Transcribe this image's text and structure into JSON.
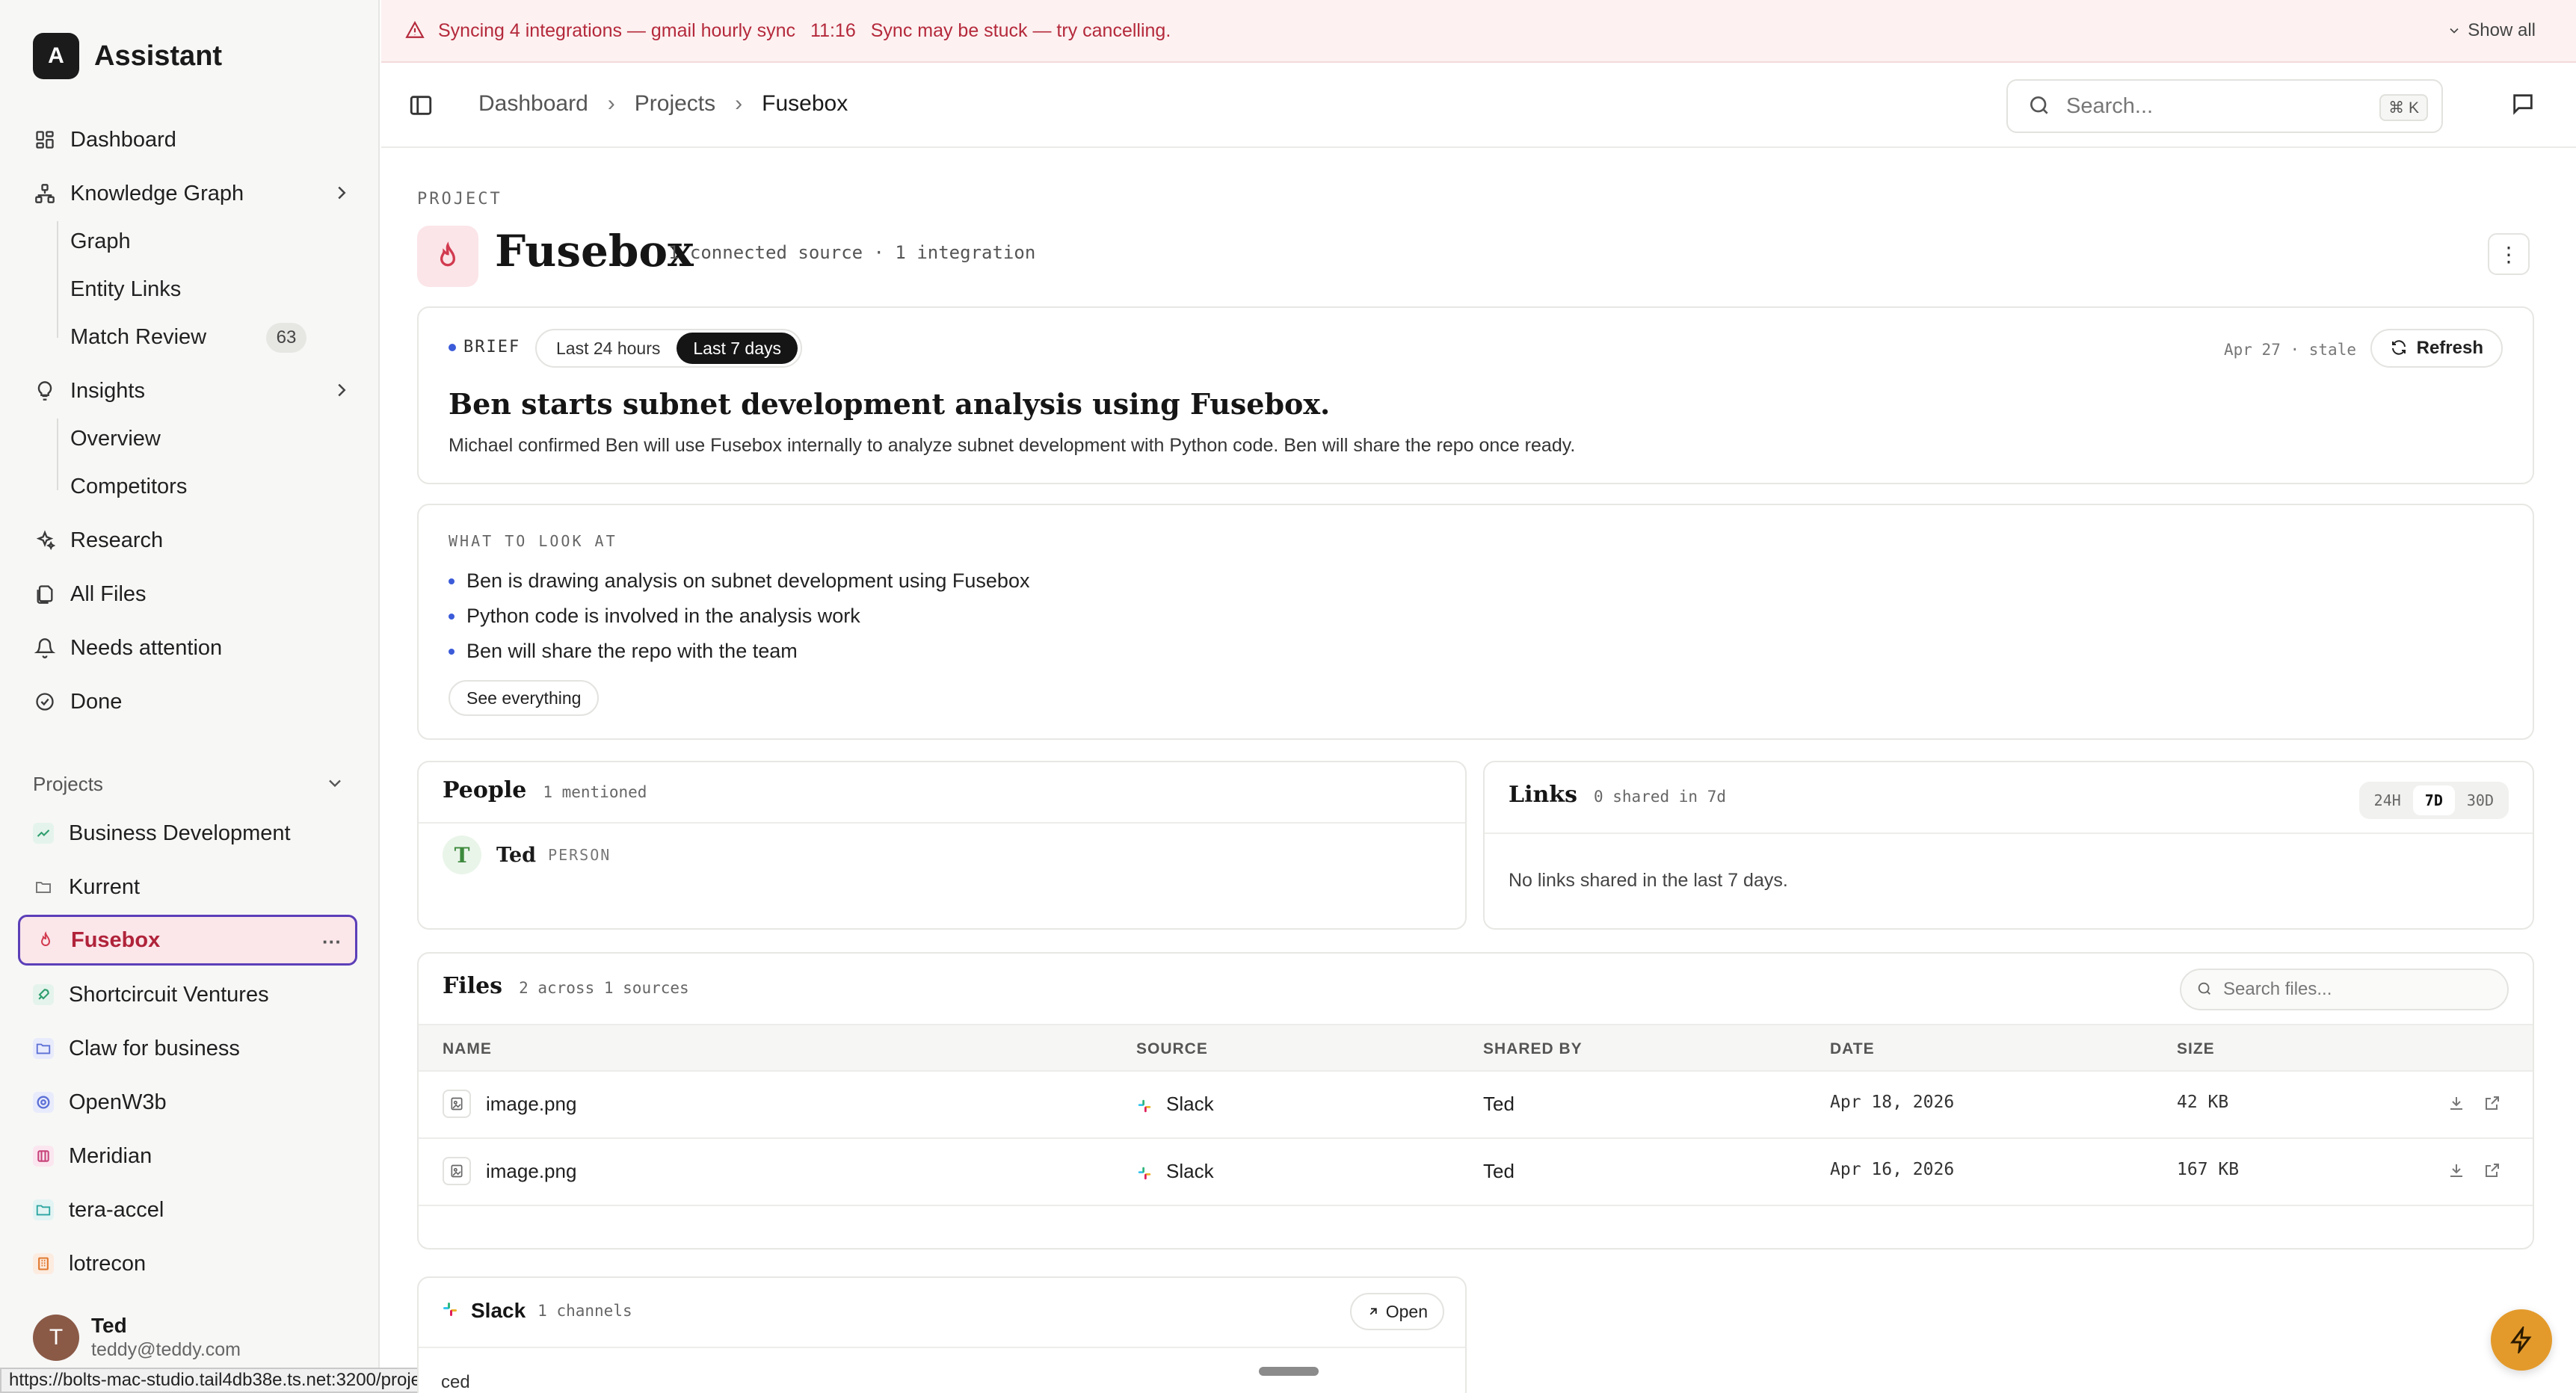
{
  "app": {
    "logo_letter": "A",
    "name": "Assistant"
  },
  "sidebar": {
    "nav": [
      {
        "label": "Dashboard",
        "icon": "dashboard-icon"
      },
      {
        "label": "Knowledge Graph",
        "icon": "graph-icon",
        "expandable": true
      },
      {
        "label": "Insights",
        "icon": "lightbulb-icon",
        "expandable": true
      },
      {
        "label": "Research",
        "icon": "sparkle-icon"
      },
      {
        "label": "All Files",
        "icon": "files-icon"
      },
      {
        "label": "Needs attention",
        "icon": "bell-icon"
      },
      {
        "label": "Done",
        "icon": "check-circle-icon"
      }
    ],
    "knowledge_graph_sub": [
      {
        "label": "Graph"
      },
      {
        "label": "Entity Links"
      },
      {
        "label": "Match Review",
        "badge": "63"
      }
    ],
    "insights_sub": [
      {
        "label": "Overview"
      },
      {
        "label": "Competitors"
      }
    ],
    "projects_label": "Projects",
    "projects": [
      {
        "label": "Business Development",
        "color": "#2f9e6e"
      },
      {
        "label": "Kurrent",
        "color": "#7a7a7a"
      },
      {
        "label": "Fusebox",
        "color": "#d23a4f",
        "active": true
      },
      {
        "label": "Shortcircuit Ventures",
        "color": "#2f9e6e"
      },
      {
        "label": "Claw for business",
        "color": "#5b6fd6"
      },
      {
        "label": "OpenW3b",
        "color": "#5b6fd6"
      },
      {
        "label": "Meridian",
        "color": "#c7437a"
      },
      {
        "label": "tera-accel",
        "color": "#2aa5a0"
      },
      {
        "label": "lotrecon",
        "color": "#e0782f"
      }
    ],
    "active_more": "···",
    "user": {
      "initial": "T",
      "name": "Ted",
      "email": "teddy@teddy.com"
    }
  },
  "status_url": "https://bolts-mac-studio.tail4db38e.ts.net:3200/projects/fusebox",
  "banner": {
    "text": "Syncing 4 integrations — gmail hourly sync",
    "time": "11:16",
    "stuck": "Sync may be stuck — try cancelling.",
    "show_all": "Show all"
  },
  "header": {
    "breadcrumbs": [
      "Dashboard",
      "Projects",
      "Fusebox"
    ],
    "separator": "›",
    "search_placeholder": "Search...",
    "shortcut": "⌘ K"
  },
  "project": {
    "eyebrow": "PROJECT",
    "title": "Fusebox",
    "meta": "1 connected source · 1 integration",
    "more": "⋮"
  },
  "brief": {
    "tag": "BRIEF",
    "ranges": [
      "Last 24 hours",
      "Last 7 days"
    ],
    "selected_range": "Last 7 days",
    "stale": "Apr 27 · stale",
    "refresh": "Refresh",
    "headline": "Ben starts subnet development analysis using Fusebox.",
    "body": "Michael confirmed Ben will use Fusebox internally to analyze subnet development with Python code. Ben will share the repo once ready."
  },
  "look": {
    "label": "WHAT TO LOOK AT",
    "items": [
      "Ben is drawing analysis on subnet development using Fusebox",
      "Python code is involved in the analysis work",
      "Ben will share the repo with the team"
    ],
    "see_everything": "See everything"
  },
  "people": {
    "title": "People",
    "sub": "1 mentioned",
    "items": [
      {
        "initial": "T",
        "name": "Ted",
        "type": "PERSON"
      }
    ]
  },
  "links": {
    "title": "Links",
    "sub": "0 shared in 7d",
    "ranges": [
      "24H",
      "7D",
      "30D"
    ],
    "selected": "7D",
    "empty": "No links shared in the last 7 days."
  },
  "files": {
    "title": "Files",
    "sub": "2 across 1 sources",
    "search_placeholder": "Search files...",
    "columns": [
      "NAME",
      "SOURCE",
      "SHARED BY",
      "DATE",
      "SIZE"
    ],
    "rows": [
      {
        "name": "image.png",
        "source": "Slack",
        "shared_by": "Ted",
        "date": "Apr 18, 2026",
        "size": "42 KB"
      },
      {
        "name": "image.png",
        "source": "Slack",
        "shared_by": "Ted",
        "date": "Apr 16, 2026",
        "size": "167 KB"
      }
    ]
  },
  "slack": {
    "name": "Slack",
    "channels": "1 channels",
    "open": "Open",
    "partial": "ced"
  },
  "colors": {
    "accent_red": "#d23a4f",
    "active_border": "#5b3fb8",
    "fab": "#e39a2b"
  }
}
